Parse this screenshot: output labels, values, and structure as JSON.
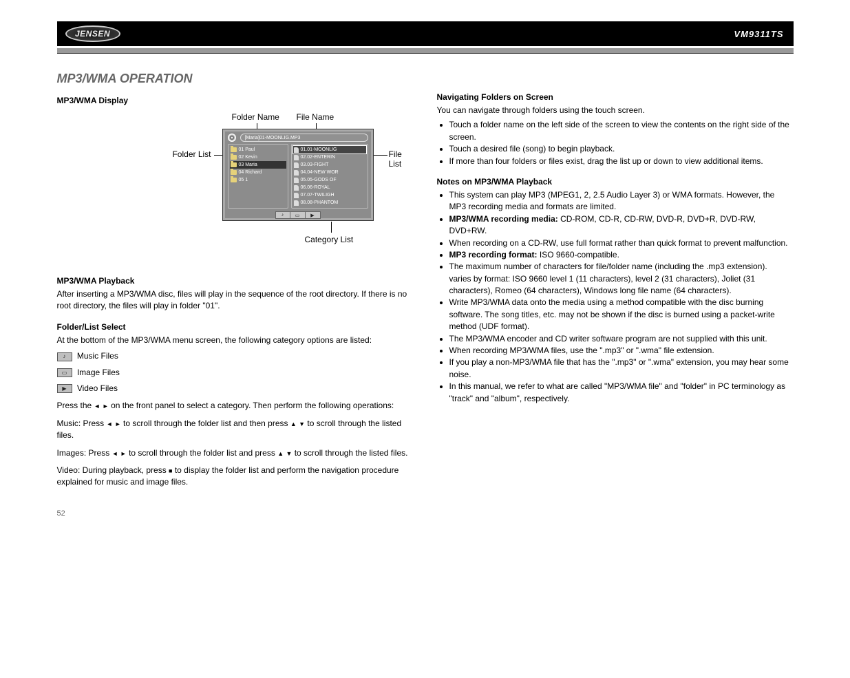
{
  "brand": "JENSEN",
  "model": "VM9311TS",
  "page_left": {
    "title": "MP3/WMA OPERATION",
    "sub1": "MP3/WMA Display",
    "screen": {
      "header_path": "[Maria]01-MOONLIG.MP3",
      "folders": [
        "01 Paul",
        "02 Kevin",
        "03 Maria",
        "04 Richard",
        "05 1"
      ],
      "folder_selected_index": 2,
      "files": [
        "01.01-MOONLIG",
        "02.02-ENTERIN",
        "03.03-FIGHT",
        "04.04-NEW WOR",
        "05.05-GODS OF",
        "06.06-ROYAL",
        "07.07-TWILIGH",
        "08.08-PHANTOM"
      ],
      "file_selected_index": 0
    },
    "labels": {
      "folder_name": "Folder Name",
      "file_name": "File Name",
      "folder_list": "Folder List",
      "file_list": "File List",
      "category_list": "Category List"
    },
    "sub2": "MP3/WMA Playback",
    "para_play": "After inserting a MP3/WMA disc, files will play in the sequence of the root directory. If there is no root directory, the files will play in folder \"01\".",
    "sub3": "Folder/List Select",
    "para_list_intro": "At the bottom of the MP3/WMA menu screen, the following category options are listed:",
    "cat_music": "Music Files",
    "cat_images": "Image Files",
    "cat_video": "Video Files",
    "para_lr_1a": "Press the ",
    "para_lr_1b": " on the front panel to select a category. Then perform the following operations:",
    "para_music_a": "Music: Press ",
    "para_music_b": " to scroll through the folder list and then press ",
    "para_music_c": " to scroll through the listed files.",
    "para_images_a": "Images: Press ",
    "para_images_b": " to scroll through the folder list and press ",
    "para_images_c": " to scroll through the listed files.",
    "para_vid_a": "Video: During playback, press ",
    "para_vid_b": " to display the folder list and perform the navigation procedure explained for music and image files.",
    "left_arrow": "◄",
    "right_arrow": "►",
    "up_arrow": "▲",
    "down_arrow": "▼",
    "stop_square": "■"
  },
  "page_right": {
    "sub1": "Navigating Folders on Screen",
    "para1": "You can navigate through folders using the touch screen.",
    "li1": "Touch a folder name on the left side of the screen to view the contents on the right side of the screen.",
    "li2": "Touch a desired file (song) to begin playback.",
    "li3": "If more than four folders or files exist, drag the list up or down to view additional items.",
    "sub2": "Notes on MP3/WMA Playback",
    "li_a": "This system can play MP3 (MPEG1, 2, 2.5 Audio Layer 3) or WMA formats. However, the MP3 recording media and formats are limited.",
    "li_b_label": "MP3/WMA recording media:",
    "li_b_val": " CD-ROM, CD-R, CD-RW, DVD-R, DVD+R, DVD-RW, DVD+RW.",
    "li_c": "When recording on a CD-RW, use full format rather than quick format to prevent malfunction.",
    "li_d_label": "MP3 recording format:",
    "li_d_val": " ISO 9660-compatible.",
    "li_e": "The maximum number of characters for file/folder name (including the .mp3 extension). varies by format: ISO 9660 level 1 (11 characters), level 2 (31 characters), Joliet (31 characters), Romeo (64 characters), Windows long file name (64 characters).",
    "li_f": "Write MP3/WMA data onto the media using a method compatible with the disc burning software. The song titles, etc. may not be shown if the disc is burned using a packet-write method (UDF format).",
    "li_g": "The MP3/WMA encoder and CD writer software program are not supplied with this unit.",
    "li_h": "When recording MP3/WMA files, use the \".mp3\" or \".wma\" file extension.",
    "li_i": "If you play a non-MP3/WMA file that has the \".mp3\" or \".wma\" extension, you may hear some noise.",
    "li_j": "In this manual, we refer to what are called \"MP3/WMA file\" and \"folder\" in PC terminology as \"track\" and \"album\", respectively."
  },
  "page_number": "52"
}
